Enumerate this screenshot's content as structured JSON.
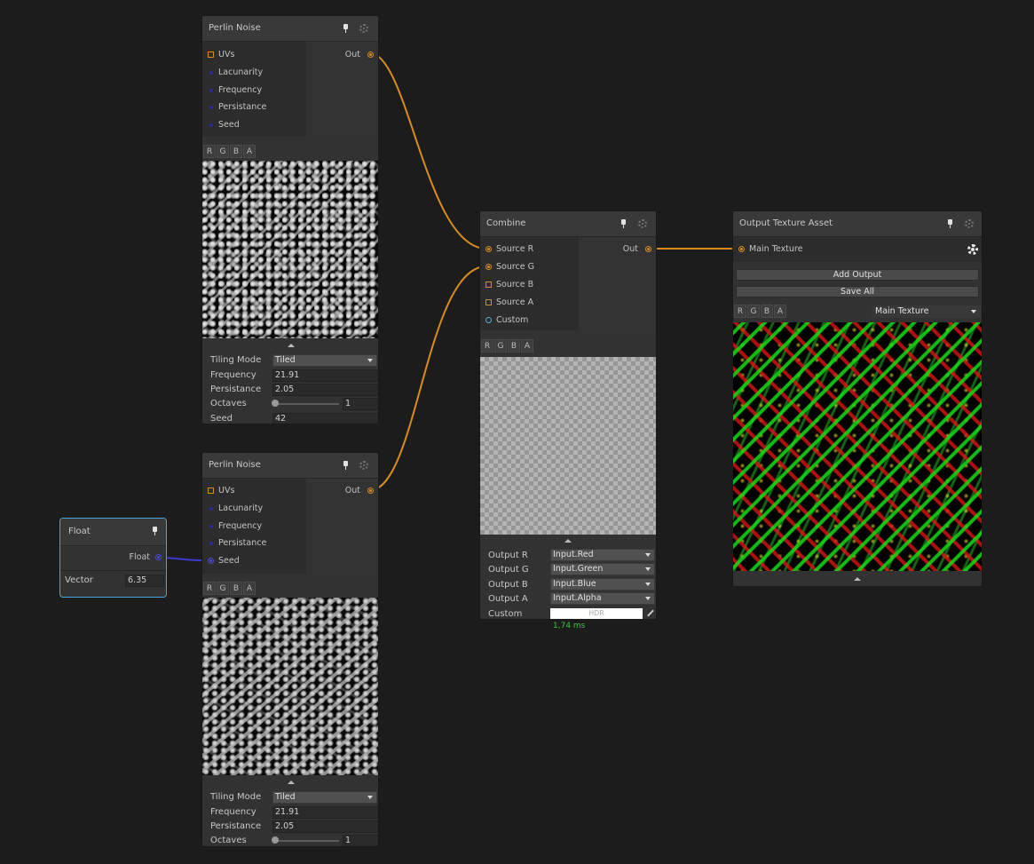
{
  "channel_buttons": [
    "R",
    "G",
    "B",
    "A"
  ],
  "icons": {
    "pin": "pin-icon",
    "settings": "gear-icon",
    "collapse": "collapse-arrow-icon"
  },
  "colors": {
    "texture_wire": "#d98b1e",
    "float_wire": "#3b3bd0",
    "selected_border": "#44a6da",
    "timing_text": "#37c837"
  },
  "perlin1": {
    "title": "Perlin Noise",
    "inputs": [
      "UVs",
      "Lacunarity",
      "Frequency",
      "Persistance",
      "Seed"
    ],
    "output": "Out",
    "settings": {
      "tiling_mode_label": "Tiling Mode",
      "tiling_mode_value": "Tiled",
      "frequency_label": "Frequency",
      "frequency_value": "21.91",
      "persistance_label": "Persistance",
      "persistance_value": "2.05",
      "octaves_label": "Octaves",
      "octaves_value": "1",
      "seed_label": "Seed",
      "seed_value": "42"
    }
  },
  "perlin2": {
    "title": "Perlin Noise",
    "inputs": [
      "UVs",
      "Lacunarity",
      "Frequency",
      "Persistance",
      "Seed"
    ],
    "output": "Out",
    "settings": {
      "tiling_mode_label": "Tiling Mode",
      "tiling_mode_value": "Tiled",
      "frequency_label": "Frequency",
      "frequency_value": "21.91",
      "persistance_label": "Persistance",
      "persistance_value": "2.05",
      "octaves_label": "Octaves",
      "octaves_value": "1"
    }
  },
  "float_node": {
    "title": "Float",
    "output": "Float",
    "vector_label": "Vector",
    "vector_value": "6.35"
  },
  "combine": {
    "title": "Combine",
    "inputs": [
      "Source R",
      "Source G",
      "Source B",
      "Source A",
      "Custom"
    ],
    "output": "Out",
    "outputs": [
      {
        "label": "Output R",
        "value": "Input.Red"
      },
      {
        "label": "Output G",
        "value": "Input.Green"
      },
      {
        "label": "Output B",
        "value": "Input.Blue"
      },
      {
        "label": "Output A",
        "value": "Input.Alpha"
      }
    ],
    "custom_label": "Custom",
    "custom_color_text": "HDR",
    "timing": "1,74 ms"
  },
  "output_asset": {
    "title": "Output Texture Asset",
    "input": "Main Texture",
    "add_output": "Add Output",
    "save_all": "Save All",
    "texture_select": "Main Texture"
  }
}
